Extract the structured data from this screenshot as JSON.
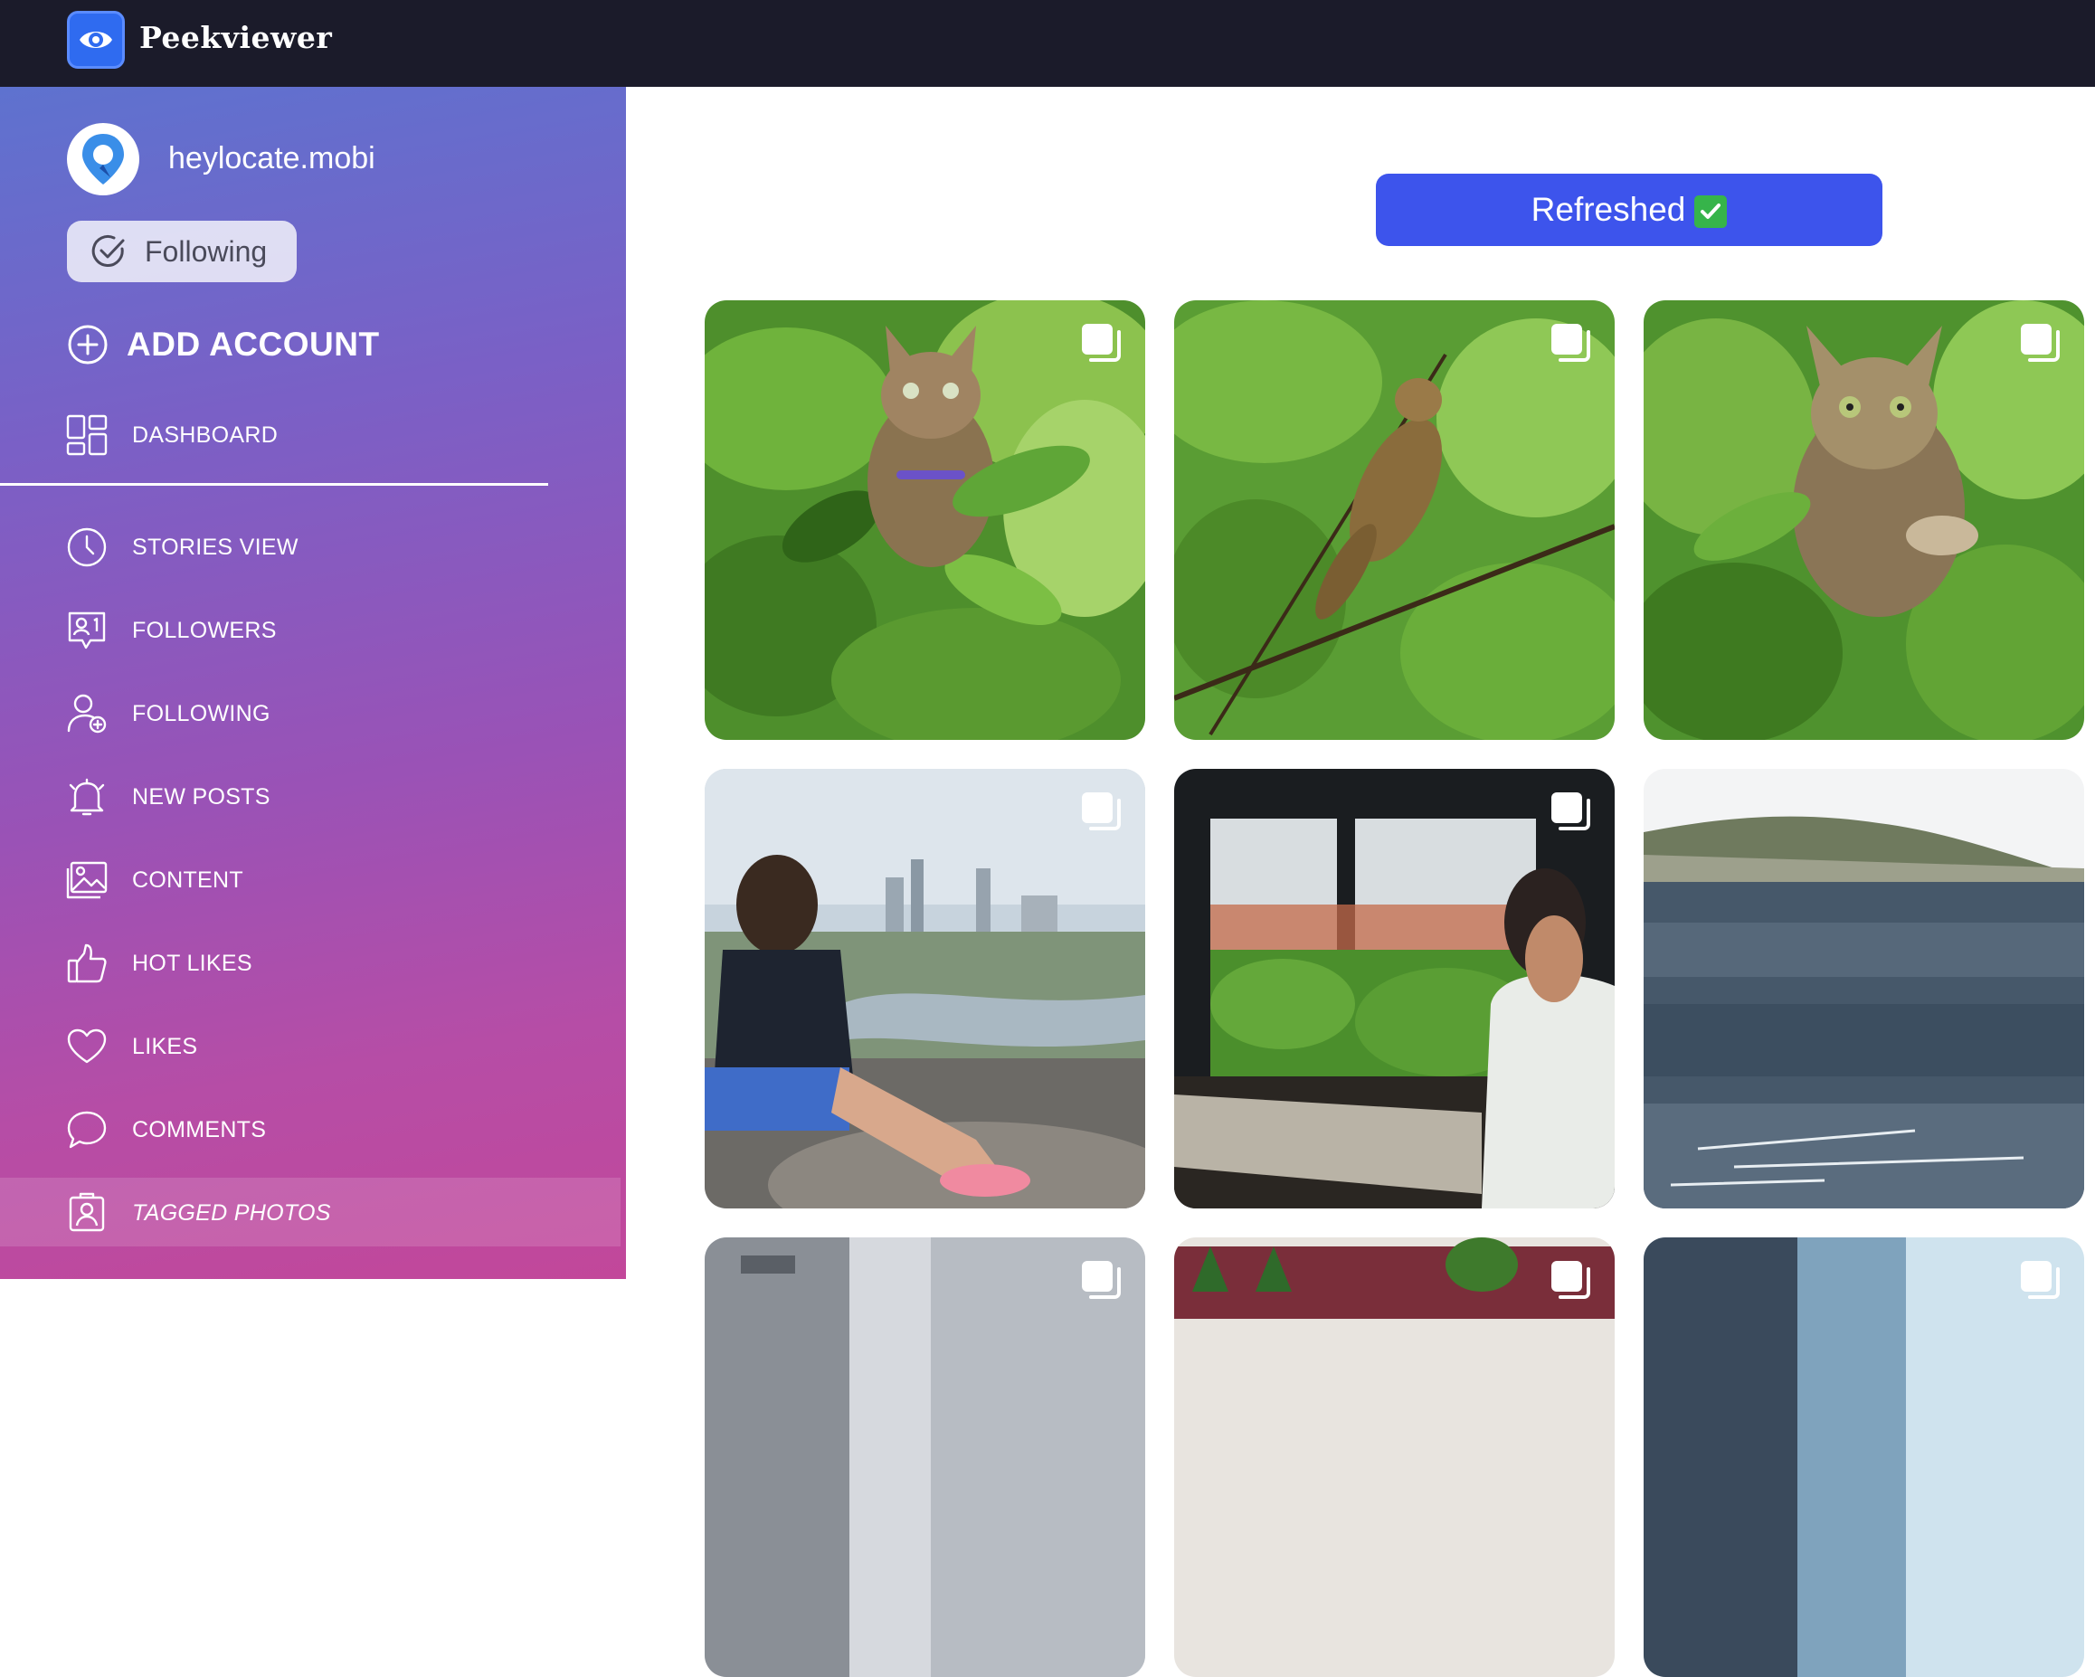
{
  "app": {
    "title": "Peekviewer",
    "logo_icon": "eye-icon",
    "topbar_color": "#1b1b2a"
  },
  "account": {
    "name": "heylocate.mobi",
    "avatar_icon": "location-pin-icon",
    "follow_label": "Following"
  },
  "sidebar": {
    "add_account_label": "ADD ACCOUNT",
    "items": [
      {
        "label": "DASHBOARD",
        "icon": "dashboard-icon"
      },
      {
        "label": "STORIES VIEW",
        "icon": "clock-icon"
      },
      {
        "label": "FOLLOWERS",
        "icon": "followers-icon"
      },
      {
        "label": "FOLLOWING",
        "icon": "add-user-icon"
      },
      {
        "label": "NEW POSTS",
        "icon": "bell-icon"
      },
      {
        "label": "CONTENT",
        "icon": "image-icon"
      },
      {
        "label": "HOT LIKES",
        "icon": "thumbs-up-icon"
      },
      {
        "label": "LIKES",
        "icon": "heart-icon"
      },
      {
        "label": "COMMENTS",
        "icon": "comment-icon"
      },
      {
        "label": "TAGGED PHOTOS",
        "icon": "tagged-person-icon",
        "active": true
      }
    ]
  },
  "main": {
    "refresh_label": "Refreshed",
    "refresh_badge": "✅",
    "accent_color": "#3d54ec",
    "posts": [
      {
        "subject": "cat in tree",
        "multi": true
      },
      {
        "subject": "cat climbing branch",
        "multi": true
      },
      {
        "subject": "cat among leaves",
        "multi": true
      },
      {
        "subject": "woman overlooking city",
        "multi": true
      },
      {
        "subject": "woman at window",
        "multi": true
      },
      {
        "subject": "sea and hillside town",
        "multi": false
      },
      {
        "subject": "building",
        "multi": true
      },
      {
        "subject": "red roofs",
        "multi": true
      },
      {
        "subject": "city buildings",
        "multi": true
      }
    ]
  }
}
